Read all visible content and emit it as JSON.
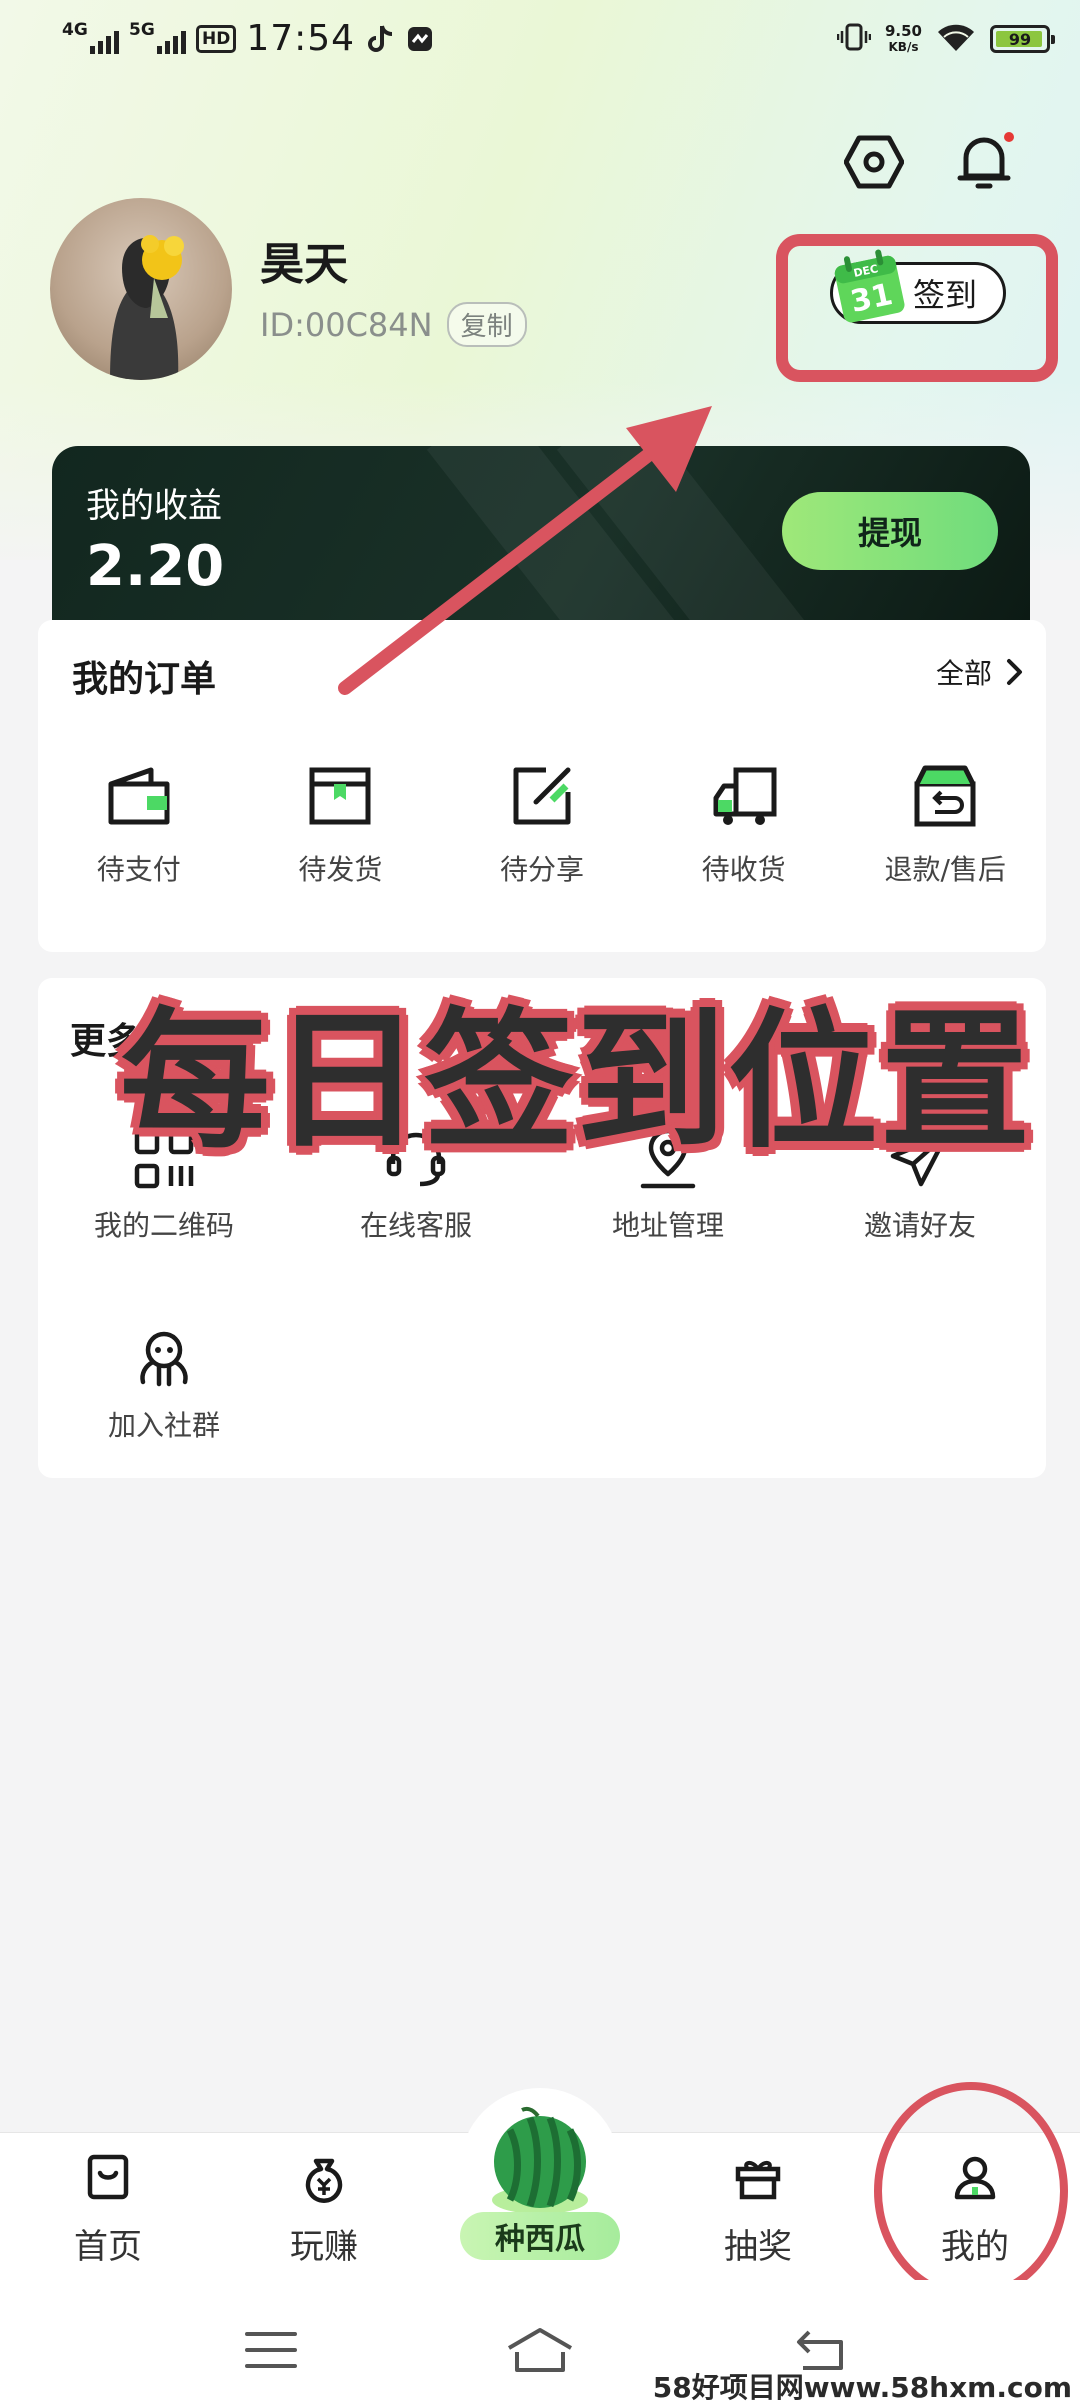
{
  "status_bar": {
    "signal_1": "4G",
    "signal_2": "5G",
    "hd_label": "HD",
    "time": "17:54",
    "net_speed_value": "9.50",
    "net_speed_unit": "KB/s",
    "battery": "99"
  },
  "profile": {
    "username": "昊天",
    "user_id": "ID:00C84N",
    "copy_label": "复制",
    "checkin_label": "签到",
    "calendar_month": "DEC",
    "calendar_day": "31"
  },
  "earnings": {
    "title": "我的收益",
    "amount": "2.20",
    "withdraw_label": "提现"
  },
  "orders": {
    "title": "我的订单",
    "all_label": "全部",
    "items": [
      {
        "label": "待支付",
        "icon": "wallet-icon"
      },
      {
        "label": "待发货",
        "icon": "package-icon"
      },
      {
        "label": "待分享",
        "icon": "share-edit-icon"
      },
      {
        "label": "待收货",
        "icon": "truck-icon"
      },
      {
        "label": "退款/售后",
        "icon": "return-box-icon"
      }
    ]
  },
  "more_services": {
    "title": "更多",
    "items": [
      {
        "label": "我的二维码",
        "icon": "qr-code-icon"
      },
      {
        "label": "在线客服",
        "icon": "headset-icon"
      },
      {
        "label": "地址管理",
        "icon": "location-pin-icon"
      },
      {
        "label": "邀请好友",
        "icon": "paper-plane-icon"
      },
      {
        "label": "加入社群",
        "icon": "community-icon"
      }
    ]
  },
  "annotation": {
    "text": "每日签到位置",
    "color": "#d9545f"
  },
  "tabbar": {
    "home": "首页",
    "earn": "玩赚",
    "center": "种西瓜",
    "lottery": "抽奖",
    "mine": "我的"
  },
  "watermark": "58好项目网www.58hxm.com",
  "colors": {
    "accent_green": "#7ee07a",
    "card_dark": "#12271f",
    "annotation_red": "#d9545f"
  }
}
